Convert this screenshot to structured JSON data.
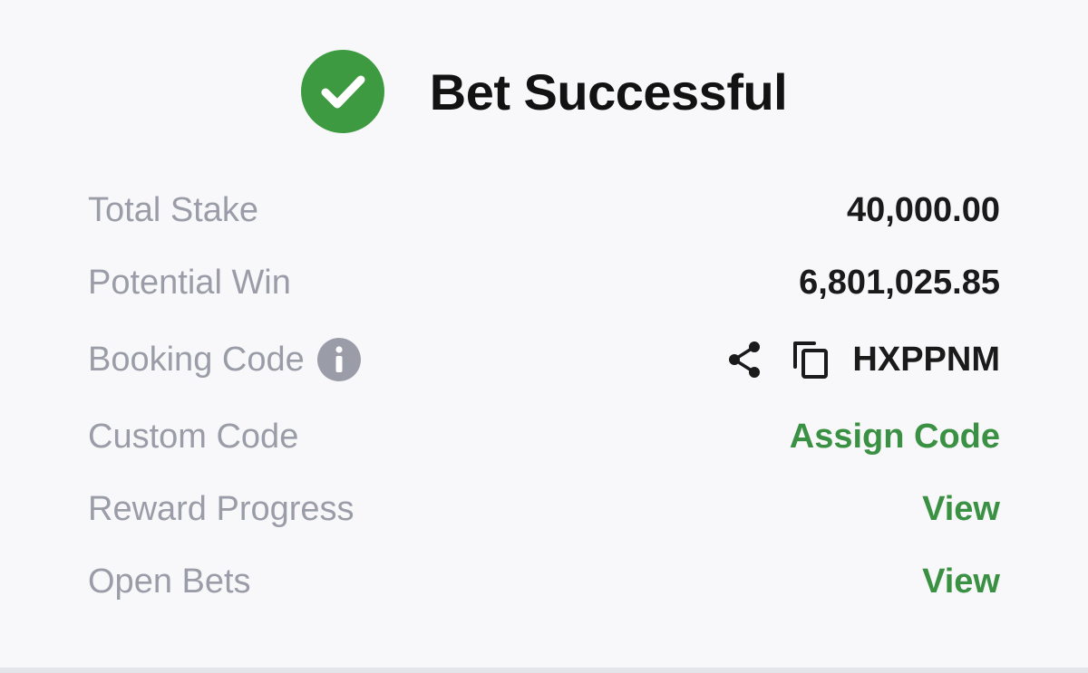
{
  "header": {
    "title": "Bet Successful",
    "icon": "check-circle-icon",
    "icon_color": "#3d9a40"
  },
  "rows": {
    "total_stake": {
      "label": "Total Stake",
      "value": "40,000.00"
    },
    "potential_win": {
      "label": "Potential Win",
      "value": "6,801,025.85"
    },
    "booking_code": {
      "label": "Booking Code",
      "value": "HXPPNM",
      "info_icon": "info-icon",
      "share_icon": "share-icon",
      "copy_icon": "copy-icon"
    },
    "custom_code": {
      "label": "Custom Code",
      "link": "Assign Code"
    },
    "reward_progress": {
      "label": "Reward Progress",
      "link": "View"
    },
    "open_bets": {
      "label": "Open Bets",
      "link": "View"
    }
  },
  "colors": {
    "label": "#9a9da8",
    "value": "#1a1a1a",
    "link": "#3b9143",
    "background": "#f8f8fa"
  }
}
